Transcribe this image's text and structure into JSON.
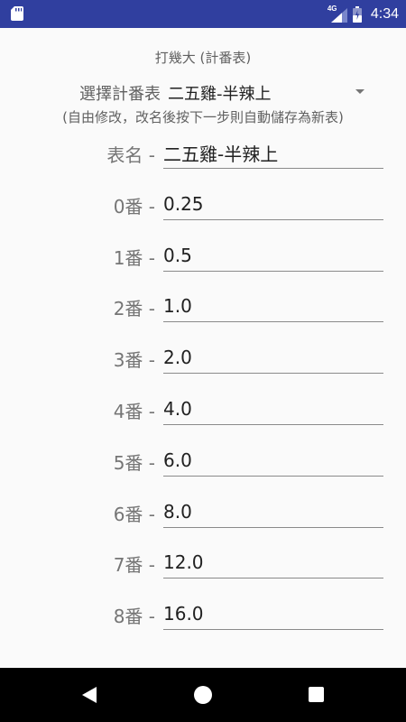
{
  "status_bar": {
    "network_label": "4G",
    "time": "4:34"
  },
  "title": "打幾大 (計番表)",
  "table_select": {
    "label": "選擇計番表",
    "value": "二五雞-半辣上"
  },
  "hint": "(自由修改，改名後按下一步則自動儲存為新表)",
  "table_name": {
    "label": "表名 -",
    "value": "二五雞-半辣上"
  },
  "fan_fields": [
    {
      "label": "0番 -",
      "value": "0.25"
    },
    {
      "label": "1番 -",
      "value": "0.5"
    },
    {
      "label": "2番 -",
      "value": "1.0"
    },
    {
      "label": "3番 -",
      "value": "2.0"
    },
    {
      "label": "4番 -",
      "value": "4.0"
    },
    {
      "label": "5番 -",
      "value": "6.0"
    },
    {
      "label": "6番 -",
      "value": "8.0"
    },
    {
      "label": "7番 -",
      "value": "12.0"
    },
    {
      "label": "8番 -",
      "value": "16.0"
    }
  ],
  "icons": {
    "sd_card": "sd-card-icon",
    "signal": "signal-icon",
    "battery": "battery-icon",
    "dropdown": "dropdown-arrow-icon",
    "back": "back-icon",
    "home": "home-icon",
    "recent": "recent-apps-icon"
  },
  "colors": {
    "status_bar": "#303f9f",
    "background": "#fafafa",
    "nav_bar": "#000000"
  }
}
